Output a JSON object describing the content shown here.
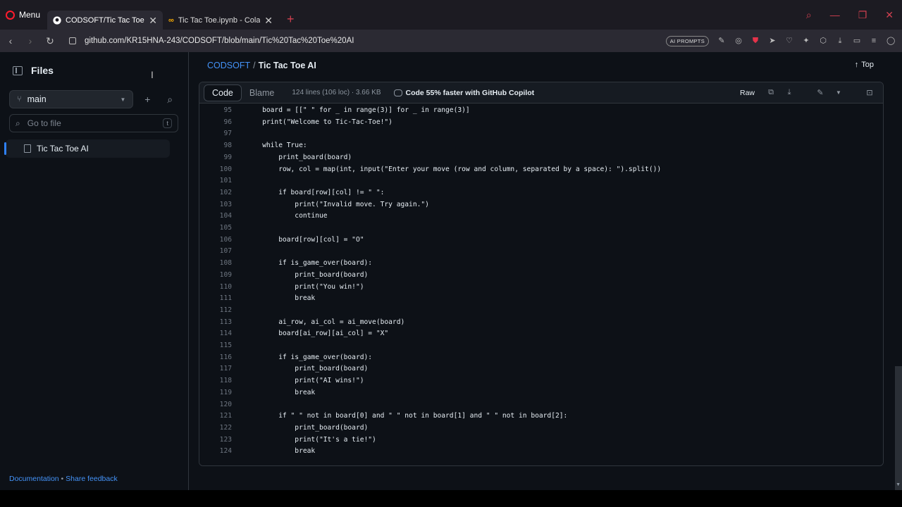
{
  "browser": {
    "menu_label": "Menu",
    "tabs": [
      {
        "title": "CODSOFT/Tic Tac Toe AI at",
        "active": true
      },
      {
        "title": "Tic Tac Toe.ipynb - Colabora",
        "active": false
      }
    ],
    "new_tab": "+",
    "url": "github.com/KR15HNA-243/CODSOFT/blob/main/Tic%20Tac%20Toe%20AI",
    "ai_prompts_label": "AI PROMPTS"
  },
  "sidebar": {
    "title": "Files",
    "branch": "main",
    "goto_placeholder": "Go to file",
    "goto_shortcut": "t",
    "tree": [
      {
        "name": "Tic Tac Toe AI"
      }
    ],
    "footer_docs": "Documentation",
    "footer_dot": "•",
    "footer_feedback": "Share feedback"
  },
  "main": {
    "breadcrumb_repo": "CODSOFT",
    "breadcrumb_sep": "/",
    "breadcrumb_file": "Tic Tac Toe AI",
    "top_link": "Top",
    "tab_code": "Code",
    "tab_blame": "Blame",
    "file_meta": "124 lines (106 loc) · 3.66 KB",
    "copilot": "Code 55% faster with GitHub Copilot",
    "raw_label": "Raw",
    "code_lines": [
      {
        "n": "95",
        "t": "    board = [[\" \" for _ in range(3)] for _ in range(3)]"
      },
      {
        "n": "96",
        "t": "    print(\"Welcome to Tic-Tac-Toe!\")"
      },
      {
        "n": "97",
        "t": ""
      },
      {
        "n": "98",
        "t": "    while True:"
      },
      {
        "n": "99",
        "t": "        print_board(board)"
      },
      {
        "n": "100",
        "t": "        row, col = map(int, input(\"Enter your move (row and column, separated by a space): \").split())"
      },
      {
        "n": "101",
        "t": ""
      },
      {
        "n": "102",
        "t": "        if board[row][col] != \" \":"
      },
      {
        "n": "103",
        "t": "            print(\"Invalid move. Try again.\")"
      },
      {
        "n": "104",
        "t": "            continue"
      },
      {
        "n": "105",
        "t": ""
      },
      {
        "n": "106",
        "t": "        board[row][col] = \"O\""
      },
      {
        "n": "107",
        "t": ""
      },
      {
        "n": "108",
        "t": "        if is_game_over(board):"
      },
      {
        "n": "109",
        "t": "            print_board(board)"
      },
      {
        "n": "110",
        "t": "            print(\"You win!\")"
      },
      {
        "n": "111",
        "t": "            break"
      },
      {
        "n": "112",
        "t": ""
      },
      {
        "n": "113",
        "t": "        ai_row, ai_col = ai_move(board)"
      },
      {
        "n": "114",
        "t": "        board[ai_row][ai_col] = \"X\""
      },
      {
        "n": "115",
        "t": ""
      },
      {
        "n": "116",
        "t": "        if is_game_over(board):"
      },
      {
        "n": "117",
        "t": "            print_board(board)"
      },
      {
        "n": "118",
        "t": "            print(\"AI wins!\")"
      },
      {
        "n": "119",
        "t": "            break"
      },
      {
        "n": "120",
        "t": ""
      },
      {
        "n": "121",
        "t": "        if \" \" not in board[0] and \" \" not in board[1] and \" \" not in board[2]:"
      },
      {
        "n": "122",
        "t": "            print_board(board)"
      },
      {
        "n": "123",
        "t": "            print(\"It's a tie!\")"
      },
      {
        "n": "124",
        "t": "            break"
      }
    ]
  },
  "colors": {
    "accent_blue": "#4493f8",
    "opera_red": "#ff1b2d",
    "bg": "#0d1117",
    "border": "#30363d"
  }
}
